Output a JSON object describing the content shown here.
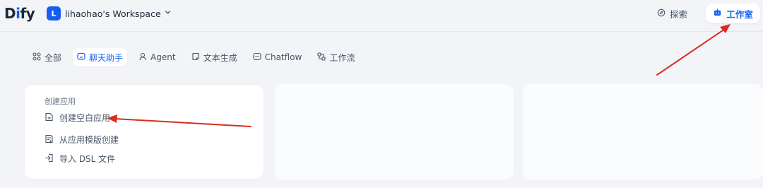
{
  "header": {
    "logo_main": "D",
    "logo_i": "i",
    "logo_rest": "fy",
    "workspace": {
      "avatar_letter": "L",
      "name": "lihaohao's Workspace"
    },
    "nav": {
      "explore": "探索",
      "studio": "工作室"
    }
  },
  "tabs": [
    {
      "label": "全部",
      "icon": "grid-icon",
      "active": false
    },
    {
      "label": "聊天助手",
      "icon": "chat-icon",
      "active": true
    },
    {
      "label": "Agent",
      "icon": "agent-icon",
      "active": false
    },
    {
      "label": "文本生成",
      "icon": "document-icon",
      "active": false
    },
    {
      "label": "Chatflow",
      "icon": "chatflow-icon",
      "active": false
    },
    {
      "label": "工作流",
      "icon": "workflow-icon",
      "active": false
    }
  ],
  "create_card": {
    "title": "创建应用",
    "items": [
      {
        "label": "创建空白应用",
        "icon": "blank-file-plus-icon"
      },
      {
        "label": "从应用模版创建",
        "icon": "template-file-icon"
      },
      {
        "label": "导入 DSL 文件",
        "icon": "import-icon"
      }
    ]
  },
  "colors": {
    "accent": "#155eef",
    "background": "#f2f4f7",
    "arrow": "#d92d20"
  }
}
